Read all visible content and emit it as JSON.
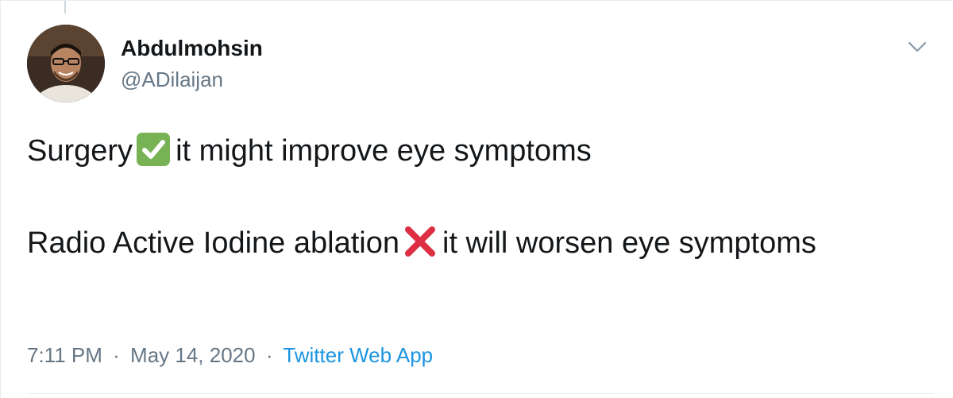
{
  "tweet": {
    "author_name": "Abdulmohsin",
    "author_handle": "@ADilaijan",
    "lines": {
      "line1_before": "Surgery",
      "line1_emoji": "check-mark-button-emoji",
      "line1_after": "it might improve eye symptoms",
      "line2_before": "Radio Active Iodine ablation",
      "line2_emoji": "cross-mark-emoji",
      "line2_after": "it will worsen eye symptoms"
    },
    "time": "7:11 PM",
    "separator": "·",
    "date": "May 14, 2020",
    "source": "Twitter Web App"
  },
  "colors": {
    "text": "#14171a",
    "secondary": "#657786",
    "link": "#1b95e0",
    "check_green": "#77b255",
    "cross_red": "#dd2e44"
  }
}
